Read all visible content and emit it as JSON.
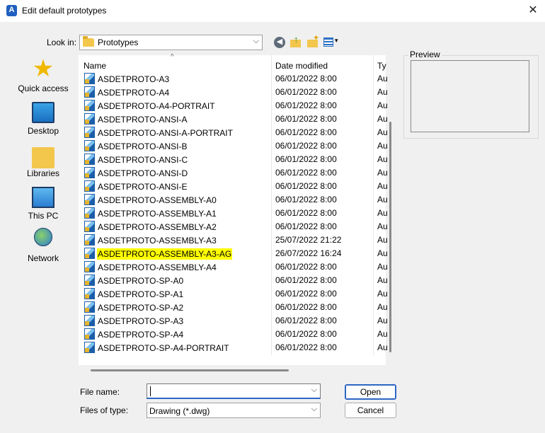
{
  "window": {
    "title": "Edit default prototypes",
    "app_icon_letter": "A",
    "close_glyph": "✕"
  },
  "lookin": {
    "label": "Look in:",
    "value": "Prototypes",
    "chevron": "⌵"
  },
  "toolbar": {
    "back_glyph": "◀",
    "up_glyph": "↑",
    "new_glyph": "✦",
    "views_chevron": "▾"
  },
  "places": [
    {
      "label": "Quick access",
      "icon": "quick-access-star-icon"
    },
    {
      "label": "Desktop",
      "icon": "desktop-icon"
    },
    {
      "label": "Libraries",
      "icon": "libraries-folder-icon"
    },
    {
      "label": "This PC",
      "icon": "this-pc-icon"
    },
    {
      "label": "Network",
      "icon": "network-icon"
    }
  ],
  "columns": {
    "name": "Name",
    "date": "Date modified",
    "type": "Ty",
    "sort_glyph": "^"
  },
  "files": [
    {
      "name": "ASDETPROTO-A3",
      "date": "06/01/2022 8:00",
      "type": "Au"
    },
    {
      "name": "ASDETPROTO-A4",
      "date": "06/01/2022 8:00",
      "type": "Au"
    },
    {
      "name": "ASDETPROTO-A4-PORTRAIT",
      "date": "06/01/2022 8:00",
      "type": "Au"
    },
    {
      "name": "ASDETPROTO-ANSI-A",
      "date": "06/01/2022 8:00",
      "type": "Au"
    },
    {
      "name": "ASDETPROTO-ANSI-A-PORTRAIT",
      "date": "06/01/2022 8:00",
      "type": "Au"
    },
    {
      "name": "ASDETPROTO-ANSI-B",
      "date": "06/01/2022 8:00",
      "type": "Au"
    },
    {
      "name": "ASDETPROTO-ANSI-C",
      "date": "06/01/2022 8:00",
      "type": "Au"
    },
    {
      "name": "ASDETPROTO-ANSI-D",
      "date": "06/01/2022 8:00",
      "type": "Au"
    },
    {
      "name": "ASDETPROTO-ANSI-E",
      "date": "06/01/2022 8:00",
      "type": "Au"
    },
    {
      "name": "ASDETPROTO-ASSEMBLY-A0",
      "date": "06/01/2022 8:00",
      "type": "Au"
    },
    {
      "name": "ASDETPROTO-ASSEMBLY-A1",
      "date": "06/01/2022 8:00",
      "type": "Au"
    },
    {
      "name": "ASDETPROTO-ASSEMBLY-A2",
      "date": "06/01/2022 8:00",
      "type": "Au"
    },
    {
      "name": "ASDETPROTO-ASSEMBLY-A3",
      "date": "25/07/2022 21:22",
      "type": "Au"
    },
    {
      "name": "ASDETPROTO-ASSEMBLY-A3-AG",
      "date": "26/07/2022 16:24",
      "type": "Au",
      "highlight": true
    },
    {
      "name": "ASDETPROTO-ASSEMBLY-A4",
      "date": "06/01/2022 8:00",
      "type": "Au"
    },
    {
      "name": "ASDETPROTO-SP-A0",
      "date": "06/01/2022 8:00",
      "type": "Au"
    },
    {
      "name": "ASDETPROTO-SP-A1",
      "date": "06/01/2022 8:00",
      "type": "Au"
    },
    {
      "name": "ASDETPROTO-SP-A2",
      "date": "06/01/2022 8:00",
      "type": "Au"
    },
    {
      "name": "ASDETPROTO-SP-A3",
      "date": "06/01/2022 8:00",
      "type": "Au"
    },
    {
      "name": "ASDETPROTO-SP-A4",
      "date": "06/01/2022 8:00",
      "type": "Au"
    },
    {
      "name": "ASDETPROTO-SP-A4-PORTRAIT",
      "date": "06/01/2022 8:00",
      "type": "Au"
    }
  ],
  "preview": {
    "label": "Preview"
  },
  "filename": {
    "label": "File name:",
    "value": "",
    "chevron": "⌵"
  },
  "filetype": {
    "label": "Files of type:",
    "value": "Drawing (*.dwg)",
    "chevron": "⌵"
  },
  "buttons": {
    "open": "Open",
    "cancel": "Cancel"
  },
  "colors": {
    "highlight": "#ffff00",
    "accent": "#2d66c6"
  }
}
